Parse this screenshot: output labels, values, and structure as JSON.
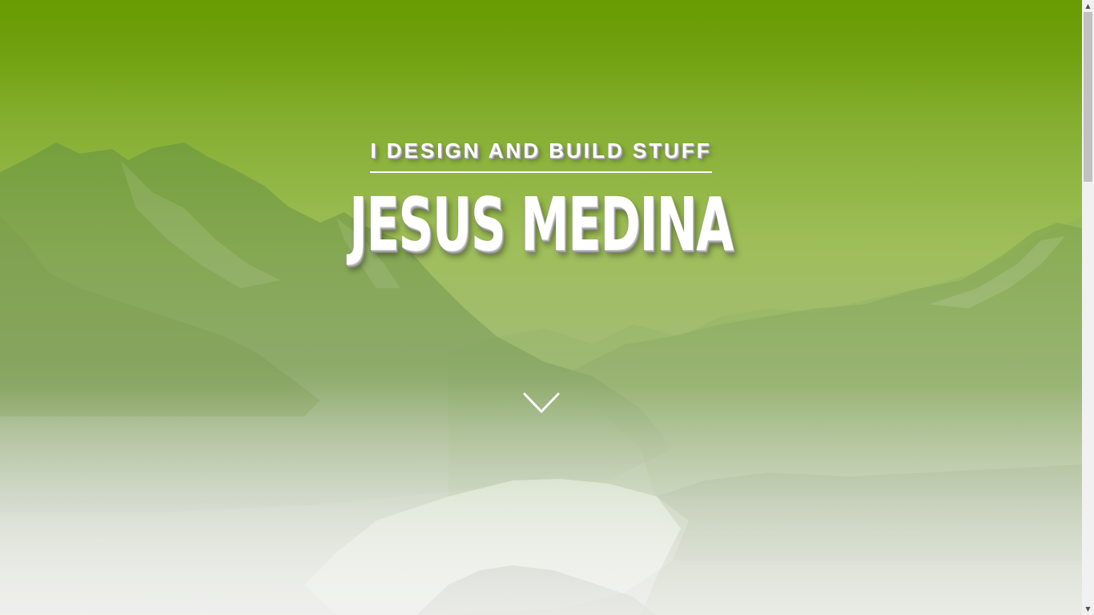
{
  "hero": {
    "tagline": "I DESIGN AND BUILD STUFF",
    "name": "JESUS MEDINA",
    "scroll_icon": "chevron-down-icon"
  },
  "colors": {
    "sky_top": "#6a9c04",
    "sky_mid": "#9fbe5a",
    "bottom_haze": "#dcdfd8",
    "text": "#ffffff"
  },
  "scrollbar": {
    "up_icon": "scroll-up-arrow-icon",
    "down_icon": "scroll-down-arrow-icon"
  }
}
